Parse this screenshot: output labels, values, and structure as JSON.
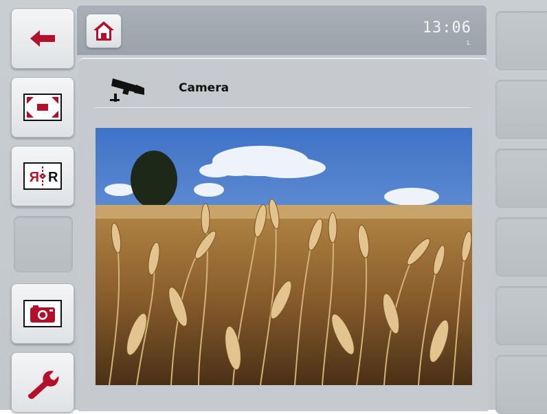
{
  "header": {
    "home_icon": "home-icon",
    "time": "13:06",
    "time_sub": "1."
  },
  "panel": {
    "title": "Camera",
    "icon": "camera-icon"
  },
  "left_softkeys": [
    {
      "icon": "arrow-left-icon"
    },
    {
      "icon": "fullscreen-icon"
    },
    {
      "icon": "mirror-image-icon",
      "label": "R"
    },
    {
      "icon": ""
    },
    {
      "icon": "screenshot-camera-icon"
    },
    {
      "icon": "wrench-icon"
    }
  ],
  "colors": {
    "accent": "#b3112b",
    "header": "#a2a9b0",
    "panel": "#c6cacf"
  }
}
